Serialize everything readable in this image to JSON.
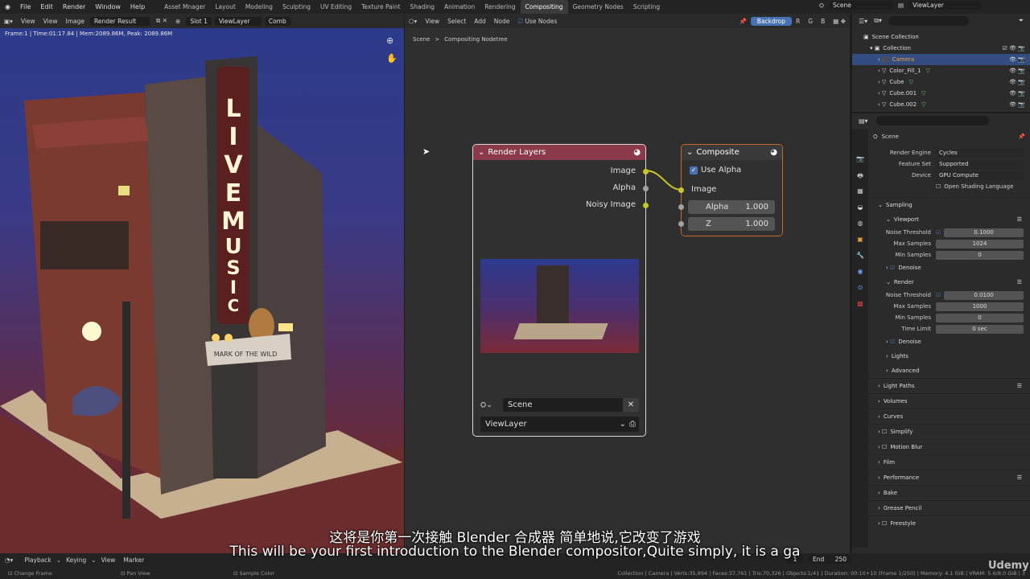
{
  "topbar": {
    "menus": [
      "File",
      "Edit",
      "Render",
      "Window",
      "Help"
    ],
    "workspaces": [
      "Asset Mnager",
      "Layout",
      "Modeling",
      "Sculpting",
      "UV Editing",
      "Texture Paint",
      "Shading",
      "Animation",
      "Rendering",
      "Compositing",
      "Geometry Nodes",
      "Scripting"
    ],
    "active_workspace": "Compositing",
    "scene": "Scene",
    "view_layer": "ViewLayer"
  },
  "image_editor": {
    "menus": [
      "View",
      "View",
      "Image"
    ],
    "image": "Render Result",
    "slot": "Slot 1",
    "layer": "ViewLayer",
    "pass": "Comb",
    "info": "Frame:1 | Time:01:17.84 | Mem:2089.86M, Peak: 2089.86M"
  },
  "node_editor": {
    "menus": [
      "View",
      "Select",
      "Add",
      "Node"
    ],
    "use_nodes": "Use Nodes",
    "backdrop": "Backdrop",
    "channels": [
      "R",
      "G",
      "B"
    ],
    "breadcrumb": [
      "Scene",
      "Compositing Nodetree"
    ]
  },
  "render_layers": {
    "title": "Render Layers",
    "outputs": [
      "Image",
      "Alpha",
      "Noisy Image"
    ],
    "scene": "Scene",
    "view_layer": "ViewLayer"
  },
  "composite": {
    "title": "Composite",
    "use_alpha": "Use Alpha",
    "image": "Image",
    "alpha_label": "Alpha",
    "alpha_val": "1.000",
    "z_label": "Z",
    "z_val": "1.000"
  },
  "outliner": {
    "root": "Scene Collection",
    "collection": "Collection",
    "items": [
      "Camera",
      "Color_Fill_1",
      "Cube",
      "Cube.001",
      "Cube.002"
    ]
  },
  "properties": {
    "scene": "Scene",
    "render_engine_label": "Render Engine",
    "render_engine": "Cycles",
    "feature_set_label": "Feature Set",
    "feature_set": "Supported",
    "device_label": "Device",
    "device": "GPU Compute",
    "osl": "Open Shading Language",
    "sampling": "Sampling",
    "viewport": "Viewport",
    "noise_threshold_label": "Noise Threshold",
    "vp_noise": "0.1000",
    "max_samples_label": "Max Samples",
    "vp_max": "1024",
    "min_samples_label": "Min Samples",
    "vp_min": "0",
    "denoise": "Denoise",
    "render": "Render",
    "r_noise": "0.0100",
    "r_max": "1000",
    "r_min": "0",
    "time_limit_label": "Time Limit",
    "time_limit": "0 sec",
    "denoise2": "Denoise",
    "lights": "Lights",
    "advanced": "Advanced",
    "panels": [
      "Light Paths",
      "Volumes",
      "Curves",
      "Simplify",
      "Motion Blur",
      "Film",
      "Performance",
      "Bake",
      "Grease Pencil",
      "Freestyle"
    ]
  },
  "timeline": {
    "menus": [
      "Playback",
      "Keying",
      "View",
      "Marker"
    ],
    "start": "1",
    "end_label": "End",
    "end": "250"
  },
  "statusbar": {
    "left": [
      "Change Frame",
      "Pan View",
      "Sample Color"
    ],
    "right": "Collection | Camera | Verts:35,894 | Faces:37,761 | Tris:70,326 | Objects:1/41 | Duration: 00:10+10 (Frame 1/250) | Memory: 4.1 GiB | VRAM: 5.6/8.0 GiB | 3"
  },
  "subtitles": {
    "zh": "这将是你第一次接触 Blender 合成器 简单地说,它改变了游戏",
    "en": "This will be your first introduction to the Blender compositor,Quite simply, it is a ga"
  },
  "watermark": "Udemy",
  "scene_image": {
    "sign_text": "LIVEMUSIC",
    "marquee": "MARK OF THE WILD"
  }
}
